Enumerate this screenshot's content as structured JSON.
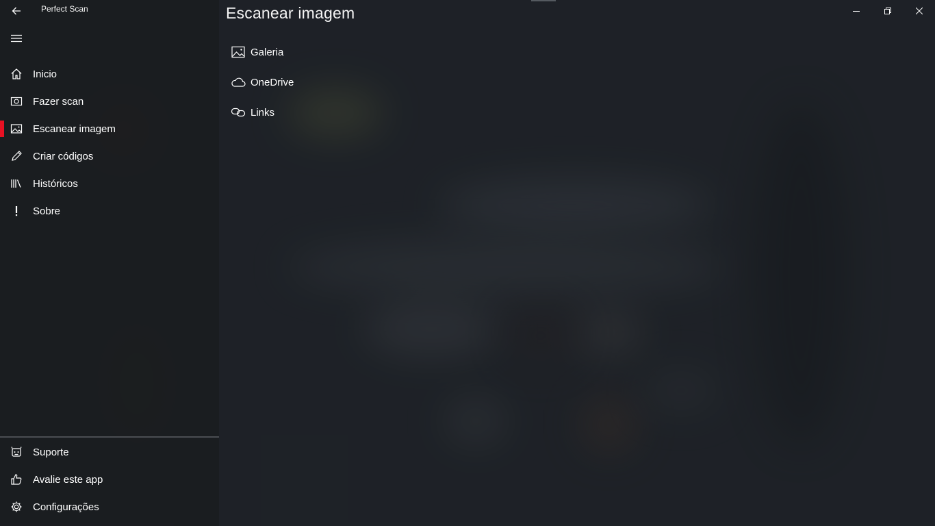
{
  "app": {
    "title": "Perfect Scan"
  },
  "sidebar": {
    "items": [
      {
        "label": "Inicio",
        "icon": "home-icon"
      },
      {
        "label": "Fazer scan",
        "icon": "camera-icon"
      },
      {
        "label": "Escanear imagem",
        "icon": "image-icon",
        "active": true
      },
      {
        "label": "Criar códigos",
        "icon": "pencil-icon"
      },
      {
        "label": "Históricos",
        "icon": "library-icon"
      },
      {
        "label": "Sobre",
        "icon": "exclamation-icon"
      }
    ],
    "footer": [
      {
        "label": "Suporte",
        "icon": "support-icon"
      },
      {
        "label": "Avalie este app",
        "icon": "thumbs-up-icon"
      },
      {
        "label": "Configurações",
        "icon": "gear-icon"
      }
    ]
  },
  "main": {
    "title": "Escanear imagem",
    "options": [
      {
        "label": "Galeria",
        "icon": "gallery-icon"
      },
      {
        "label": "OneDrive",
        "icon": "cloud-icon"
      },
      {
        "label": "Links",
        "icon": "link-icon"
      }
    ]
  },
  "colors": {
    "accent": "#e81123",
    "background": "#1f2328"
  }
}
